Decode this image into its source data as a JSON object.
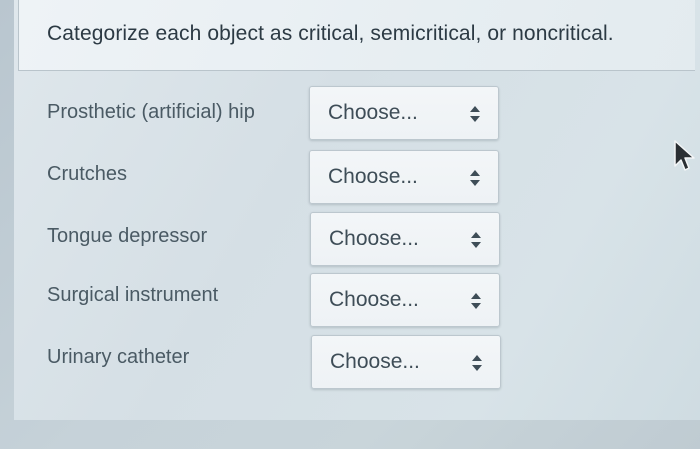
{
  "question": {
    "prompt": "Categorize each object as critical, semicritical, or noncritical."
  },
  "items": [
    {
      "label": "Prosthetic (artificial) hip",
      "selected": "Choose..."
    },
    {
      "label": "Crutches",
      "selected": "Choose..."
    },
    {
      "label": "Tongue depressor",
      "selected": "Choose..."
    },
    {
      "label": "Surgical instrument",
      "selected": "Choose..."
    },
    {
      "label": "Urinary catheter",
      "selected": "Choose..."
    }
  ],
  "icons": {
    "select_arrows": "up-down-arrows-icon",
    "pointer": "mouse-cursor-icon"
  },
  "colors": {
    "text": "#2c3a44",
    "label_text": "#4a5a64",
    "select_bg": "#f3f6f8"
  }
}
